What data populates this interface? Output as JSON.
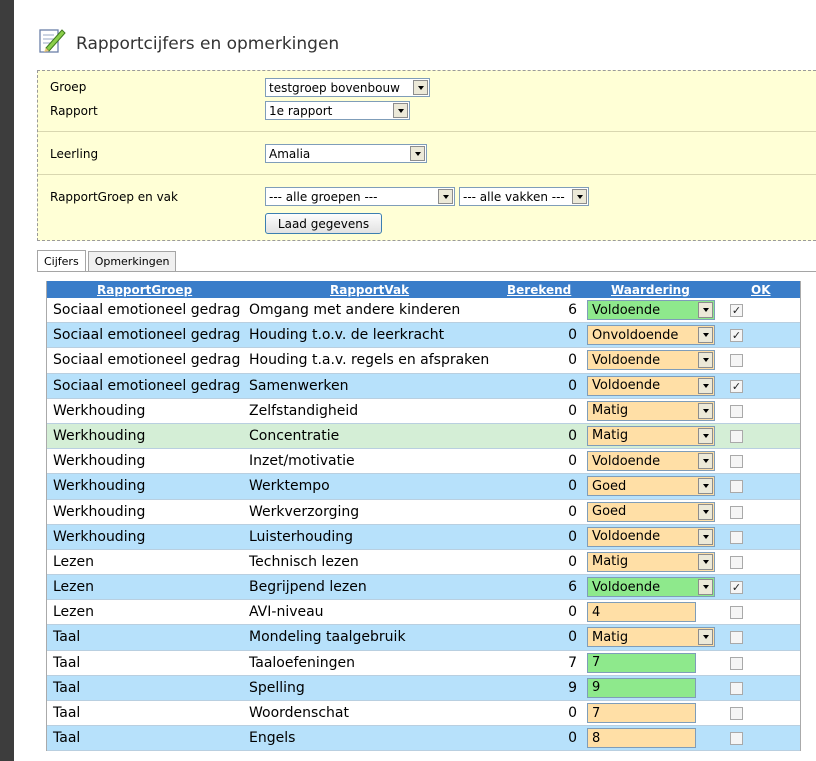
{
  "header": {
    "title": "Rapportcijfers en opmerkingen"
  },
  "filters": {
    "groep_label": "Groep",
    "groep_value": "testgroep bovenbouw",
    "rapport_label": "Rapport",
    "rapport_value": "1e rapport",
    "leerling_label": "Leerling",
    "leerling_value": "Amalia",
    "rapportgroep_label": "RapportGroep en vak",
    "rapportgroep_value": "--- alle groepen ---",
    "vak_value": "--- alle vakken ---",
    "load_button": "Laad gegevens"
  },
  "tabs": [
    {
      "label": "Cijfers"
    },
    {
      "label": "Opmerkingen"
    }
  ],
  "table": {
    "columns": [
      "RapportGroep",
      "RapportVak",
      "Berekend",
      "Waardering",
      "OK"
    ],
    "rows": [
      {
        "groep": "Sociaal emotioneel gedrag",
        "vak": "Omgang met andere kinderen",
        "berekend": "6",
        "waardering": "Voldoende",
        "ok": true
      },
      {
        "groep": "Sociaal emotioneel gedrag",
        "vak": "Houding t.o.v. de leerkracht",
        "berekend": "0",
        "waardering": "Onvoldoende",
        "ok": true
      },
      {
        "groep": "Sociaal emotioneel gedrag",
        "vak": "Houding t.a.v. regels en afspraken",
        "berekend": "0",
        "waardering": "Voldoende",
        "ok": false
      },
      {
        "groep": "Sociaal emotioneel gedrag",
        "vak": "Samenwerken",
        "berekend": "0",
        "waardering": "Voldoende",
        "ok": true
      },
      {
        "groep": "Werkhouding",
        "vak": "Zelfstandigheid",
        "berekend": "0",
        "waardering": "Matig",
        "ok": false
      },
      {
        "groep": "Werkhouding",
        "vak": "Concentratie",
        "berekend": "0",
        "waardering": "Matig",
        "ok": false
      },
      {
        "groep": "Werkhouding",
        "vak": "Inzet/motivatie",
        "berekend": "0",
        "waardering": "Voldoende",
        "ok": false
      },
      {
        "groep": "Werkhouding",
        "vak": "Werktempo",
        "berekend": "0",
        "waardering": "Goed",
        "ok": false
      },
      {
        "groep": "Werkhouding",
        "vak": "Werkverzorging",
        "berekend": "0",
        "waardering": "Goed",
        "ok": false
      },
      {
        "groep": "Werkhouding",
        "vak": "Luisterhouding",
        "berekend": "0",
        "waardering": "Voldoende",
        "ok": false
      },
      {
        "groep": "Lezen",
        "vak": "Technisch lezen",
        "berekend": "0",
        "waardering": "Matig",
        "ok": false
      },
      {
        "groep": "Lezen",
        "vak": "Begrijpend lezen",
        "berekend": "6",
        "waardering": "Voldoende",
        "ok": true
      },
      {
        "groep": "Lezen",
        "vak": "AVI-niveau",
        "berekend": "0",
        "waardering": "4",
        "ok": false
      },
      {
        "groep": "Taal",
        "vak": "Mondeling taalgebruik",
        "berekend": "0",
        "waardering": "Matig",
        "ok": false
      },
      {
        "groep": "Taal",
        "vak": "Taaloefeningen",
        "berekend": "7",
        "waardering": "7",
        "ok": false
      },
      {
        "groep": "Taal",
        "vak": "Spelling",
        "berekend": "9",
        "waardering": "9",
        "ok": false
      },
      {
        "groep": "Taal",
        "vak": "Woordenschat",
        "berekend": "0",
        "waardering": "7",
        "ok": false
      },
      {
        "groep": "Taal",
        "vak": "Engels",
        "berekend": "0",
        "waardering": "8",
        "ok": false
      }
    ]
  },
  "colors": {
    "header_bg": "#3a7dc9",
    "row_blue": "#b7e1fb",
    "row_green": "#d4eed6",
    "value_orange": "#ffdfa6",
    "value_green": "#8ee98c",
    "filter_bg": "#ffffd6"
  }
}
